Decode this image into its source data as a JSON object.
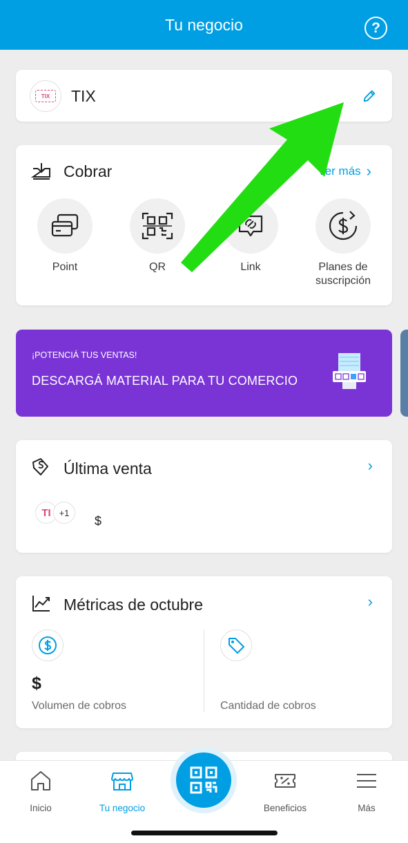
{
  "header": {
    "title": "Tu negocio",
    "help_icon": "question-circle-icon"
  },
  "store": {
    "name": "TIX",
    "logo_text": "TIX",
    "edit_icon": "pencil-icon"
  },
  "cobrar": {
    "title": "Cobrar",
    "see_more": "Ver más",
    "actions": [
      {
        "label": "Point",
        "icon": "card-reader-icon"
      },
      {
        "label": "QR",
        "icon": "qr-code-icon"
      },
      {
        "label": "Link",
        "icon": "link-bubble-icon"
      },
      {
        "label_line1": "Planes de",
        "label_line2": "suscripción",
        "icon": "recurring-dollar-icon"
      }
    ]
  },
  "promo": {
    "kicker": "¡POTENCIÁ TUS VENTAS!",
    "title": "DESCARGÁ MATERIAL PARA TU COMERCIO"
  },
  "last_sale": {
    "title": "Última venta",
    "avatar_text": "TI",
    "extra_count": "+1",
    "amount": "$"
  },
  "metrics": {
    "title": "Métricas de octubre",
    "volume_value": "$",
    "volume_label": "Volumen de cobros",
    "count_label": "Cantidad de cobros"
  },
  "tabs": [
    {
      "label": "Inicio",
      "icon": "home-icon"
    },
    {
      "label": "Tu negocio",
      "icon": "store-icon"
    },
    {
      "label": "Beneficios",
      "icon": "discount-ticket-icon"
    },
    {
      "label": "Más",
      "icon": "menu-icon"
    }
  ],
  "colors": {
    "brand": "#009ee3",
    "promo": "#7a34d6",
    "annotation_arrow": "#22dd11"
  }
}
